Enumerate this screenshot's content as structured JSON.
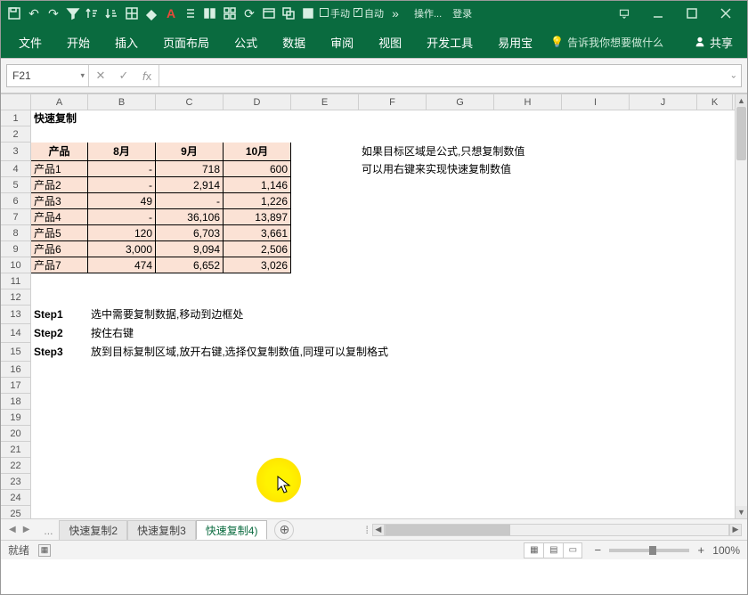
{
  "titlebar": {
    "manual_label": "手动",
    "auto_label": "自动",
    "ops_label": "操作...",
    "login_label": "登录"
  },
  "ribbon": {
    "tabs": [
      "文件",
      "开始",
      "插入",
      "页面布局",
      "公式",
      "数据",
      "审阅",
      "视图",
      "开发工具",
      "易用宝"
    ],
    "tellme_label": "告诉我你想要做什么",
    "share_label": "共享"
  },
  "formulabar": {
    "name": "F21",
    "formula": ""
  },
  "columns": [
    "A",
    "B",
    "C",
    "D",
    "E",
    "F",
    "G",
    "H",
    "I",
    "J",
    "K"
  ],
  "rows_count": 25,
  "content": {
    "title": "快速复制",
    "table_headers": [
      "产品",
      "8月",
      "9月",
      "10月"
    ],
    "table_rows": [
      {
        "name": "产品1",
        "m8": "-",
        "m9": "718",
        "m10": "600"
      },
      {
        "name": "产品2",
        "m8": "-",
        "m9": "2,914",
        "m10": "1,146"
      },
      {
        "name": "产品3",
        "m8": "49",
        "m9": "-",
        "m10": "1,226"
      },
      {
        "name": "产品4",
        "m8": "-",
        "m9": "36,106",
        "m10": "13,897"
      },
      {
        "name": "产品5",
        "m8": "120",
        "m9": "6,703",
        "m10": "3,661"
      },
      {
        "name": "产品6",
        "m8": "3,000",
        "m9": "9,094",
        "m10": "2,506"
      },
      {
        "name": "产品7",
        "m8": "474",
        "m9": "6,652",
        "m10": "3,026"
      }
    ],
    "note1": "如果目标区域是公式,只想复制数值",
    "note2": "可以用右键来实现快速复制数值",
    "steps": [
      {
        "label": "Step1",
        "text": "选中需要复制数据,移动到边框处"
      },
      {
        "label": "Step2",
        "text": "按住右键"
      },
      {
        "label": "Step3",
        "text": "放到目标复制区域,放开右键,选择仅复制数值,同理可以复制格式"
      }
    ]
  },
  "sheettabs": {
    "ellipsis": "...",
    "tabs": [
      "快速复制2",
      "快速复制3",
      "快速复制4)"
    ],
    "active_index": 2
  },
  "statusbar": {
    "ready": "就绪",
    "zoom_pct": "100%"
  }
}
